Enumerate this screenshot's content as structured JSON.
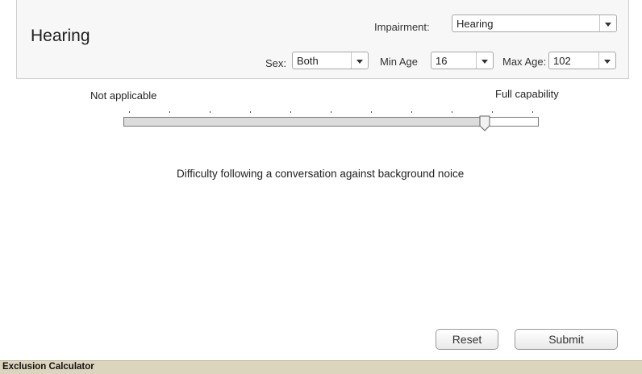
{
  "header": {
    "title": "Hearing",
    "impairment": {
      "label": "Impairment:",
      "value": "Hearing"
    },
    "sex": {
      "label": "Sex:",
      "value": "Both"
    },
    "min_age": {
      "label": "Min Age",
      "value": "16"
    },
    "max_age": {
      "label": "Max Age:",
      "value": "102"
    }
  },
  "scale": {
    "left_label": "Not applicable",
    "right_label": "Full capability",
    "tick_count": 11,
    "value_fraction": 0.87
  },
  "description": "Difficulty following a conversation against background noice",
  "buttons": {
    "reset": "Reset",
    "submit": "Submit"
  },
  "status_bar": {
    "text": "Exclusion Calculator"
  }
}
